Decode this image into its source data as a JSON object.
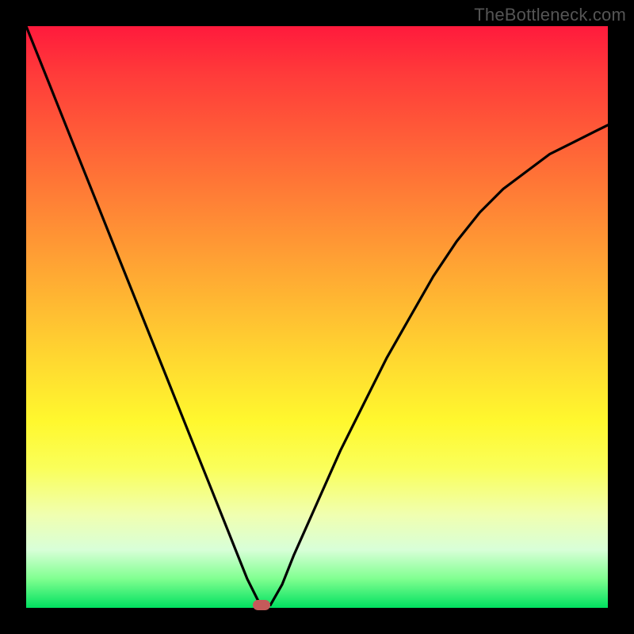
{
  "watermark": "TheBottleneck.com",
  "colors": {
    "frame": "#000000",
    "curve": "#000000",
    "marker": "#c55a5a",
    "gradient_top": "#ff1a3c",
    "gradient_bottom": "#00e060"
  },
  "chart_data": {
    "type": "line",
    "title": "",
    "xlabel": "",
    "ylabel": "",
    "xlim": [
      0,
      100
    ],
    "ylim": [
      0,
      100
    ],
    "series": [
      {
        "name": "bottleneck-curve",
        "x": [
          0,
          4,
          8,
          12,
          16,
          20,
          24,
          28,
          32,
          36,
          38,
          40,
          42,
          44,
          46,
          50,
          54,
          58,
          62,
          66,
          70,
          74,
          78,
          82,
          86,
          90,
          94,
          98,
          100
        ],
        "y": [
          100,
          90,
          80,
          70,
          60,
          50,
          40,
          30,
          20,
          10,
          5,
          1,
          0.5,
          4,
          9,
          18,
          27,
          35,
          43,
          50,
          57,
          63,
          68,
          72,
          75,
          78,
          80,
          82,
          83
        ]
      }
    ],
    "marker": {
      "x": 40.5,
      "y": 0.5
    },
    "annotations": []
  }
}
